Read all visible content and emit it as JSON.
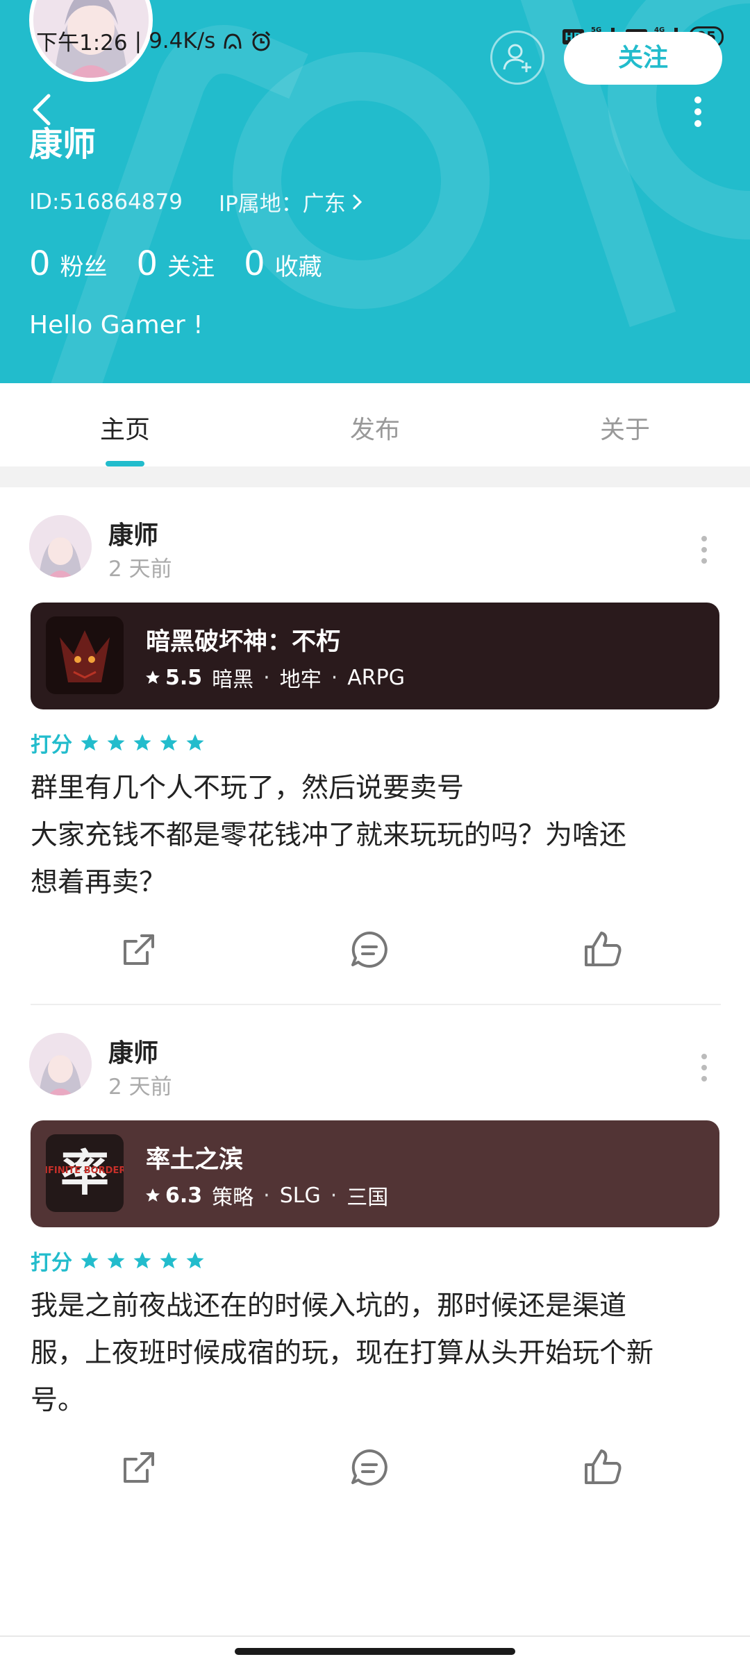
{
  "status_bar": {
    "time": "下午1:26",
    "speed": "9.4K/s",
    "net1": "5G",
    "net2": "4G",
    "hd": "HD",
    "battery": "95"
  },
  "profile": {
    "name": "康师",
    "id_text": "ID:516864879",
    "ip_text": "IP属地：广东",
    "follow_label": "关注",
    "stats": [
      {
        "num": "0",
        "label": "粉丝"
      },
      {
        "num": "0",
        "label": "关注"
      },
      {
        "num": "0",
        "label": "收藏"
      }
    ],
    "bio": "Hello Gamer !"
  },
  "tabs": [
    {
      "label": "主页",
      "active": true
    },
    {
      "label": "发布",
      "active": false
    },
    {
      "label": "关于",
      "active": false
    }
  ],
  "posts": [
    {
      "author": "康师",
      "time": "2 天前",
      "game": {
        "title": "暗黑破坏神：不朽",
        "score": "5.5",
        "tags": [
          "暗黑",
          "地牢",
          "ARPG"
        ],
        "bg_color": "#2a1a1c"
      },
      "rating_label": "打分",
      "stars": 5,
      "lines": [
        "群里有几个人不玩了，然后说要卖号",
        "大家充钱不都是零花钱冲了就来玩玩的吗？为啥还",
        "想着再卖？"
      ]
    },
    {
      "author": "康师",
      "time": "2 天前",
      "game": {
        "title": "率土之滨",
        "score": "6.3",
        "tags": [
          "策略",
          "SLG",
          "三国"
        ],
        "icon_char": "率",
        "icon_text": "INFINITE BORDERS",
        "bg_color": "#523435"
      },
      "rating_label": "打分",
      "stars": 5,
      "lines": [
        "我是之前夜战还在的时候入坑的，那时候还是渠道",
        "服，上夜班时候成宿的玩，现在打算从头开始玩个新",
        "号。"
      ]
    }
  ],
  "colors": {
    "accent": "#22bccc",
    "header_bg": "#22bccc"
  }
}
